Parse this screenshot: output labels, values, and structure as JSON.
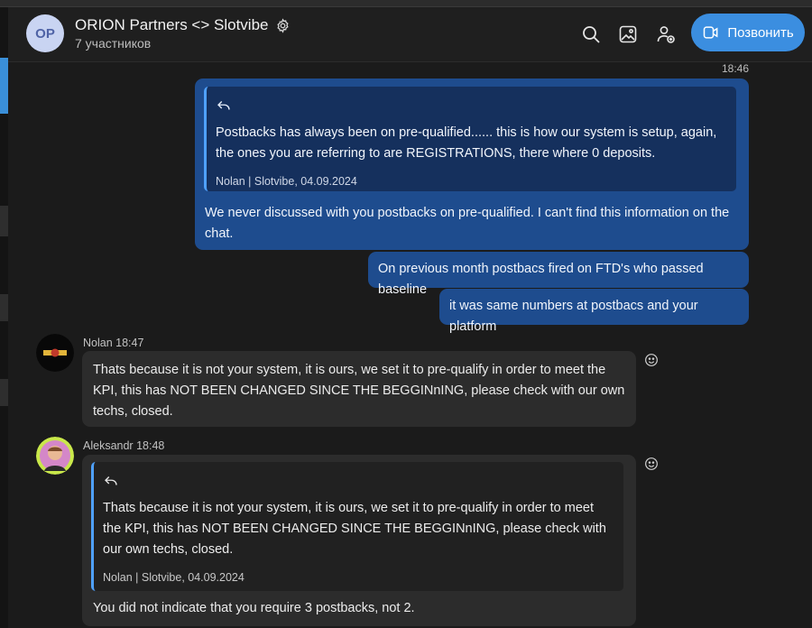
{
  "header": {
    "avatar_initials": "OP",
    "title": "ORION Partners <> Slotvibe",
    "subtitle": "7 участников",
    "call_label": "Позвонить",
    "icons": [
      "search-icon",
      "gallery-icon",
      "add-member-icon",
      "gear-icon",
      "video-call-icon"
    ]
  },
  "messages": {
    "time_1": "18:46",
    "out_1": {
      "quote_text": "Postbacks has always been on pre-qualified...... this is how our system is setup, again, the ones you are referring to are REGISTRATIONS, there where 0 deposits.",
      "quote_from": "Nolan | Slotvibe, 04.09.2024",
      "text": "We never discussed with you postbacks on pre-qualified. I can't find this information on the chat."
    },
    "out_2": {
      "text": "On previous month postbacs fired on FTD's who passed baseline"
    },
    "out_3": {
      "text": "it was same numbers at postbacs and your platform"
    },
    "in_1": {
      "sender": "Nolan",
      "time": "18:47",
      "text": "Thats because it is not your system, it is ours, we set it to pre-qualify in order to meet the KPI, this has NOT BEEN CHANGED SINCE THE BEGGINnING, please check with our own techs, closed."
    },
    "in_2": {
      "sender": "Aleksandr",
      "time": "18:48",
      "quote_text": "Thats because it is not your system, it is ours, we set it to pre-qualify in order to meet the KPI, this has NOT BEEN CHANGED SINCE THE BEGGINnING, please check with our own techs, closed.",
      "quote_from": "Nolan | Slotvibe, 04.09.2024",
      "text": "You did not indicate that you require 3 postbacks, not 2."
    }
  },
  "colors": {
    "accent": "#3b8ee0",
    "outgoing_bubble": "#1e4c8e",
    "incoming_bubble": "#2c2c2c",
    "quote_bar": "#4fa1ff"
  }
}
